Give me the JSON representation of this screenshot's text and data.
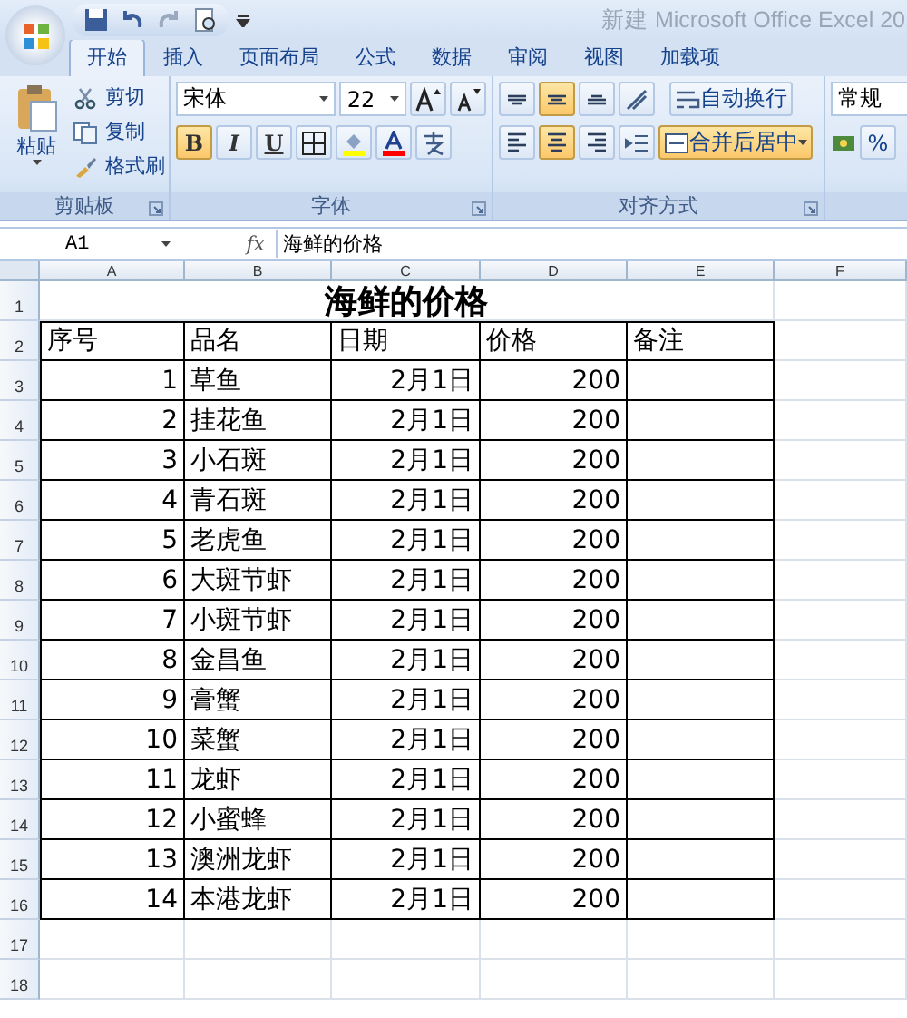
{
  "window": {
    "title": "新建 Microsoft Office Excel 20"
  },
  "tabs": [
    {
      "label": "开始",
      "selected": true
    },
    {
      "label": "插入",
      "selected": false
    },
    {
      "label": "页面布局",
      "selected": false
    },
    {
      "label": "公式",
      "selected": false
    },
    {
      "label": "数据",
      "selected": false
    },
    {
      "label": "审阅",
      "selected": false
    },
    {
      "label": "视图",
      "selected": false
    },
    {
      "label": "加载项",
      "selected": false
    }
  ],
  "clipboard": {
    "paste": "粘贴",
    "items": [
      {
        "kind": "cut",
        "label": "剪切"
      },
      {
        "kind": "copy",
        "label": "复制"
      },
      {
        "kind": "brush",
        "label": "格式刷"
      }
    ],
    "label": "剪贴板"
  },
  "font": {
    "name": "宋体",
    "size": "22",
    "styles": [
      {
        "kind": "bold",
        "label": "B",
        "selected": true
      },
      {
        "kind": "italic",
        "label": "I",
        "selected": false
      },
      {
        "kind": "underline",
        "label": "U",
        "selected": false
      }
    ],
    "label": "字体"
  },
  "alignment": {
    "vertical": [
      {
        "kind": "top",
        "selected": false
      },
      {
        "kind": "middle",
        "selected": true
      },
      {
        "kind": "bottom",
        "selected": false
      }
    ],
    "horizontal": [
      {
        "kind": "left",
        "selected": false
      },
      {
        "kind": "center",
        "selected": true
      },
      {
        "kind": "right",
        "selected": false
      }
    ],
    "wrap": {
      "label": "自动换行",
      "selected": false
    },
    "merge": {
      "label": "合并后居中",
      "selected": true
    },
    "label": "对齐方式"
  },
  "number": {
    "format": "常规",
    "percent": "%"
  },
  "formula_bar": {
    "cell": "A1",
    "fx": "fx",
    "content": "海鲜的价格"
  },
  "columns": [
    "A",
    "B",
    "C",
    "D",
    "E",
    "F"
  ],
  "sheet": {
    "title": "海鲜的价格",
    "header": [
      "序号",
      "品名",
      "日期",
      "价格",
      "备注"
    ],
    "rows": [
      [
        "1",
        "草鱼",
        "2月1日",
        "200"
      ],
      [
        "2",
        "挂花鱼",
        "2月1日",
        "200"
      ],
      [
        "3",
        "小石斑",
        "2月1日",
        "200"
      ],
      [
        "4",
        "青石斑",
        "2月1日",
        "200"
      ],
      [
        "5",
        "老虎鱼",
        "2月1日",
        "200"
      ],
      [
        "6",
        "大斑节虾",
        "2月1日",
        "200"
      ],
      [
        "7",
        "小斑节虾",
        "2月1日",
        "200"
      ],
      [
        "8",
        "金昌鱼",
        "2月1日",
        "200"
      ],
      [
        "9",
        "膏蟹",
        "2月1日",
        "200"
      ],
      [
        "10",
        "菜蟹",
        "2月1日",
        "200"
      ],
      [
        "11",
        "龙虾",
        "2月1日",
        "200"
      ],
      [
        "12",
        "小蜜蜂",
        "2月1日",
        "200"
      ],
      [
        "13",
        "澳洲龙虾",
        "2月1日",
        "200"
      ],
      [
        "14",
        "本港龙虾",
        "2月1日",
        "200"
      ]
    ],
    "row_numbers": [
      "1",
      "2",
      "3",
      "4",
      "5",
      "6",
      "7",
      "8",
      "9",
      "10",
      "11",
      "12",
      "13",
      "14",
      "15",
      "16",
      "17",
      "18"
    ]
  }
}
